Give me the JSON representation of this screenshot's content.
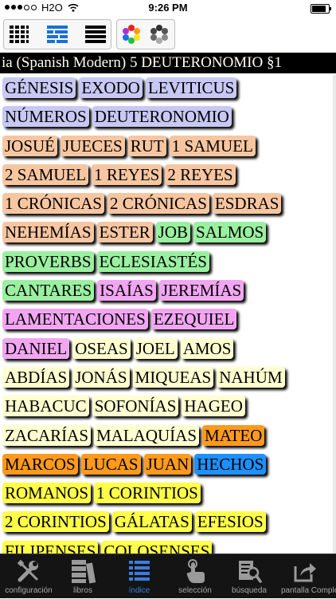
{
  "status": {
    "carrier": "H2O",
    "time": "9:26 PM"
  },
  "title": "ia (Spanish Modern) 5 DEUTERONOMIO §1",
  "colors": {
    "pentateuch": "#c8c8f4",
    "history": "#f7c6a0",
    "poetry": "#9af0a0",
    "major_prophets": "#f2a6f2",
    "minor_prophets": "#ffffd0",
    "gospels": "#ff9a1e",
    "acts": "#1e90ff",
    "epistles": "#ffff4a",
    "active_tab": "#3a7de0"
  },
  "rows": [
    [
      {
        "name": "GÉNESIS",
        "group": "pentateuch"
      },
      {
        "name": "EXODO",
        "group": "pentateuch"
      },
      {
        "name": "LEVITICUS",
        "group": "pentateuch"
      }
    ],
    [
      {
        "name": "NÚMEROS",
        "group": "pentateuch"
      },
      {
        "name": "DEUTERONOMIO",
        "group": "pentateuch"
      }
    ],
    [
      {
        "name": "JOSUÉ",
        "group": "history"
      },
      {
        "name": "JUECES",
        "group": "history"
      },
      {
        "name": "RUT",
        "group": "history"
      },
      {
        "name": "1 SAMUEL",
        "group": "history"
      }
    ],
    [
      {
        "name": "2 SAMUEL",
        "group": "history"
      },
      {
        "name": "1 REYES",
        "group": "history"
      },
      {
        "name": "2 REYES",
        "group": "history"
      }
    ],
    [
      {
        "name": "1 CRÓNICAS",
        "group": "history"
      },
      {
        "name": "2 CRÓNICAS",
        "group": "history"
      },
      {
        "name": "ESDRAS",
        "group": "history"
      }
    ],
    [
      {
        "name": "NEHEMÍAS",
        "group": "history"
      },
      {
        "name": "ESTER",
        "group": "history"
      },
      {
        "name": "JOB",
        "group": "poetry"
      },
      {
        "name": "SALMOS",
        "group": "poetry"
      }
    ],
    [
      {
        "name": "PROVERBS",
        "group": "poetry"
      },
      {
        "name": "ECLESIASTÉS",
        "group": "poetry"
      }
    ],
    [
      {
        "name": "CANTARES",
        "group": "poetry"
      },
      {
        "name": "ISAÍAS",
        "group": "major_prophets"
      },
      {
        "name": "JEREMÍAS",
        "group": "major_prophets"
      }
    ],
    [
      {
        "name": "LAMENTACIONES",
        "group": "major_prophets"
      },
      {
        "name": "EZEQUIEL",
        "group": "major_prophets"
      }
    ],
    [
      {
        "name": "DANIEL",
        "group": "major_prophets"
      },
      {
        "name": "OSEAS",
        "group": "minor_prophets"
      },
      {
        "name": "JOEL",
        "group": "minor_prophets"
      },
      {
        "name": "AMOS",
        "group": "minor_prophets"
      }
    ],
    [
      {
        "name": "ABDÍAS",
        "group": "minor_prophets"
      },
      {
        "name": "JONÁS",
        "group": "minor_prophets"
      },
      {
        "name": "MIQUEAS",
        "group": "minor_prophets"
      },
      {
        "name": "NAHÚM",
        "group": "minor_prophets"
      }
    ],
    [
      {
        "name": "HABACUC",
        "group": "minor_prophets"
      },
      {
        "name": "SOFONÍAS",
        "group": "minor_prophets"
      },
      {
        "name": "HAGEO",
        "group": "minor_prophets"
      }
    ],
    [
      {
        "name": "ZACARÍAS",
        "group": "minor_prophets"
      },
      {
        "name": "MALAQUÍAS",
        "group": "minor_prophets"
      },
      {
        "name": "MATEO",
        "group": "gospels"
      }
    ],
    [
      {
        "name": "MARCOS",
        "group": "gospels"
      },
      {
        "name": "LUCAS",
        "group": "gospels"
      },
      {
        "name": "JUAN",
        "group": "gospels"
      },
      {
        "name": "HECHOS",
        "group": "acts"
      }
    ],
    [
      {
        "name": "ROMANOS",
        "group": "epistles"
      },
      {
        "name": "1 CORINTIOS",
        "group": "epistles"
      }
    ],
    [
      {
        "name": "2 CORINTIOS",
        "group": "epistles"
      },
      {
        "name": "GÁLATAS",
        "group": "epistles"
      },
      {
        "name": "EFESIOS",
        "group": "epistles"
      }
    ],
    [
      {
        "name": "FILIPENSES",
        "group": "epistles"
      },
      {
        "name": "COLOSENSES",
        "group": "epistles"
      }
    ]
  ],
  "tabs": [
    {
      "label": "configuración",
      "icon": "wrench-screwdriver-icon",
      "active": false
    },
    {
      "label": "libros",
      "icon": "books-icon",
      "active": false
    },
    {
      "label": "índice",
      "icon": "list-icon",
      "active": true
    },
    {
      "label": "selección",
      "icon": "tap-hand-icon",
      "active": false
    },
    {
      "label": "búsqueda",
      "icon": "search-document-icon",
      "active": false
    },
    {
      "label": "pantalla Completa",
      "icon": "share-out-icon",
      "active": false
    }
  ]
}
